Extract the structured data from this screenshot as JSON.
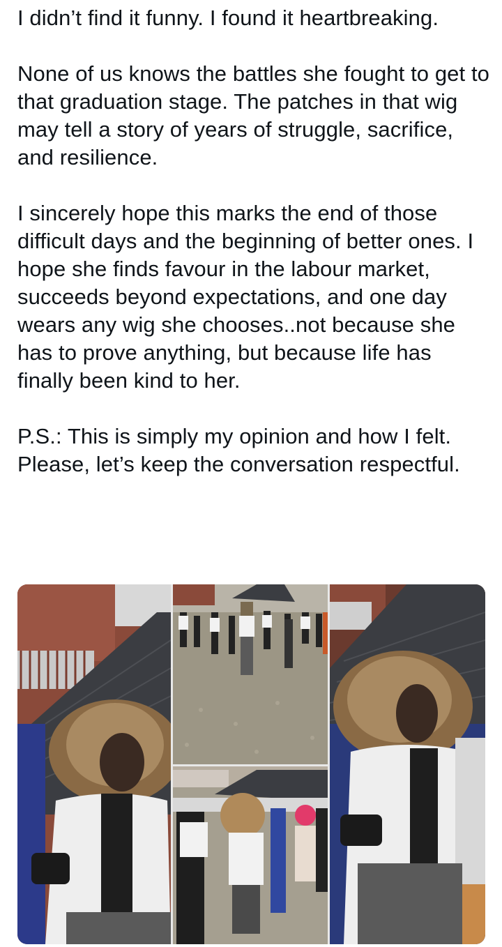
{
  "post": {
    "paragraphs": [
      "I didn’t find it funny. I found it heartbreaking.",
      "None of us knows the battles she fought to get to that graduation stage. The patches in that wig may tell a story of years of struggle, sacrifice, and resilience.",
      "I sincerely hope this marks the end of those difficult days and the beginning of better ones. I hope she finds favour in the labour market, succeeds beyond expectations, and one day wears any wig she chooses..not because she has to prove anything, but because life has finally been kind to her.",
      "P.S.: This is simply my opinion and how I felt. Please, let’s keep the conversation respectful."
    ]
  },
  "media": {
    "images": [
      "graduate-closeup-photo",
      "graduation-crowd-photo",
      "graduate-walking-photo",
      "graduate-portrait-photo"
    ]
  }
}
